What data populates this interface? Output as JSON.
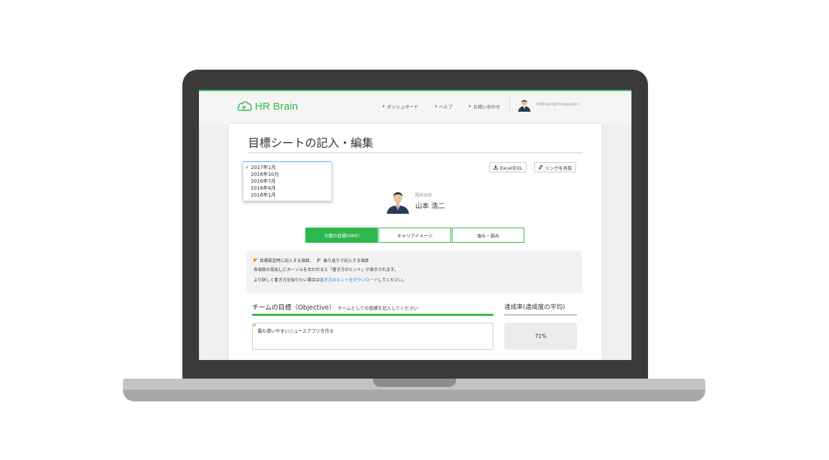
{
  "brand": {
    "name": "HR Brain",
    "accent": "#2db84d"
  },
  "header": {
    "nav": [
      {
        "label": "ダッシュボード"
      },
      {
        "label": "ヘルプ"
      },
      {
        "label": "お問い合わせ"
      }
    ],
    "user_email": "HRBrain@mosquiton"
  },
  "page": {
    "title": "目標シートの記入・編集"
  },
  "period_dropdown": {
    "selected_mark": "✓",
    "options": [
      "2017年1月",
      "2016年10月",
      "2016年7月",
      "2016年4月",
      "2016年1月"
    ]
  },
  "actions": {
    "excel_label": "ExcelをDL",
    "share_label": "リンクを共有"
  },
  "profile": {
    "department": "開発本部",
    "name": "山本 浩二"
  },
  "tabs": [
    {
      "label": "今期の目標(OKR)",
      "active": true
    },
    {
      "label": "キャリアイメージ",
      "active": false
    },
    {
      "label": "強み・弱み",
      "active": false
    }
  ],
  "info": {
    "legend_set": "目標設定時に記入する項目、",
    "legend_review": "振り返りで記入する項目",
    "hint_line": "各項目の見出しにカーソルを合わせると「書き方のヒント」が表示されます。",
    "more_prefix": "より詳しく書き方を知りたい場合は",
    "more_link": "書き方のヒントをダウンロード",
    "more_suffix": "してください。"
  },
  "objective": {
    "heading": "チームの目標（Objective）",
    "subheading": "チームとしての目標を記入してください",
    "value": "最も使いやすいニュースアプリを作る"
  },
  "achievement": {
    "heading": "達成率(達成度の平均)",
    "value": "71%"
  }
}
